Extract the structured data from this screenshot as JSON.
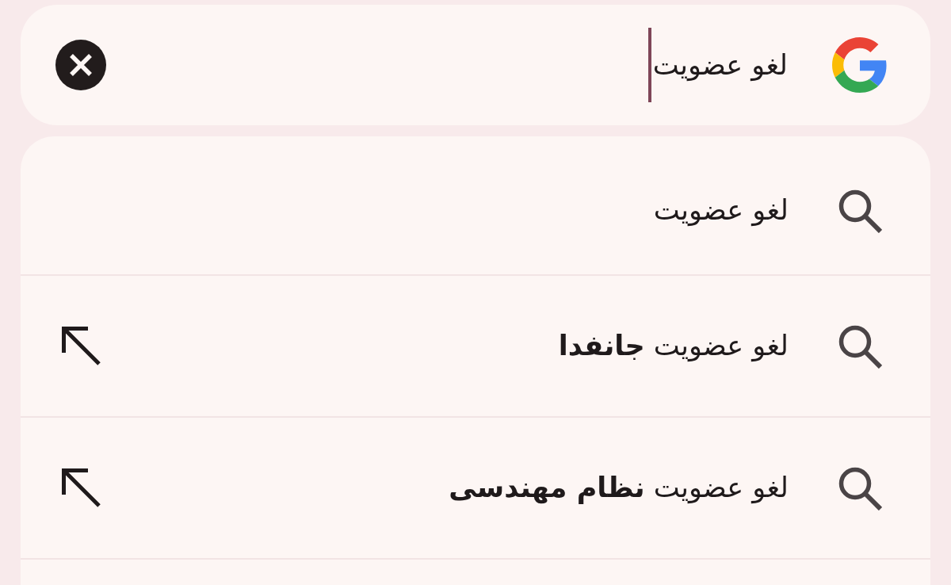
{
  "search": {
    "value": "لغو عضویت",
    "focused": true
  },
  "suggestions": [
    {
      "kind": "query",
      "text": "لغو عضویت"
    },
    {
      "kind": "completion",
      "text": "لغو عضویت **جانفدا**"
    },
    {
      "kind": "completion",
      "text": "لغو عضویت **نظام مهندسی**"
    }
  ]
}
